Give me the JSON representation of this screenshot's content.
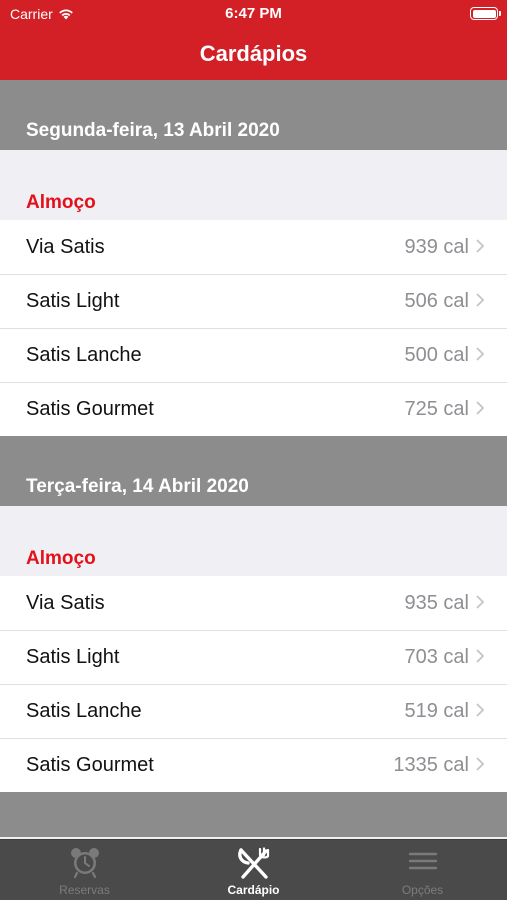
{
  "status": {
    "carrier": "Carrier",
    "time": "6:47 PM"
  },
  "nav": {
    "title": "Cardápios"
  },
  "days": [
    {
      "date": "Segunda-feira, 13 Abril 2020",
      "meal": "Almoço",
      "items": [
        {
          "name": "Via Satis",
          "cal": "939 cal"
        },
        {
          "name": "Satis Light",
          "cal": "506 cal"
        },
        {
          "name": "Satis Lanche",
          "cal": "500 cal"
        },
        {
          "name": "Satis Gourmet",
          "cal": "725 cal"
        }
      ]
    },
    {
      "date": "Terça-feira, 14 Abril 2020",
      "meal": "Almoço",
      "items": [
        {
          "name": "Via Satis",
          "cal": "935 cal"
        },
        {
          "name": "Satis Light",
          "cal": "703 cal"
        },
        {
          "name": "Satis Lanche",
          "cal": "519 cal"
        },
        {
          "name": "Satis Gourmet",
          "cal": "1335 cal"
        }
      ]
    }
  ],
  "tabs": [
    {
      "label": "Reservas",
      "icon": "alarm-clock-icon",
      "active": false
    },
    {
      "label": "Cardápio",
      "icon": "fork-knife-icon",
      "active": true
    },
    {
      "label": "Opções",
      "icon": "menu-icon",
      "active": false
    }
  ],
  "colors": {
    "brand": "#d32027",
    "accent_text": "#e3111b",
    "section_bg": "#8c8c8c",
    "tabbar_bg": "#4a4a4a"
  }
}
